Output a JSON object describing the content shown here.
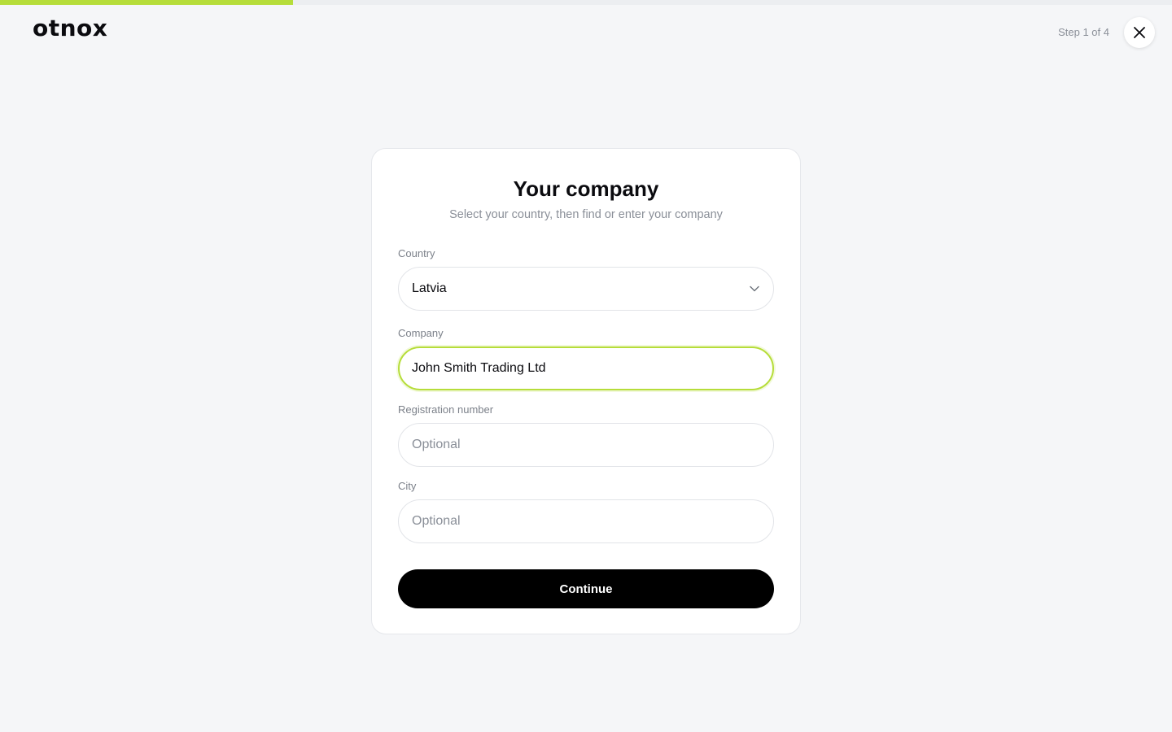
{
  "header": {
    "logo_text": "otnox",
    "step_label": "Step 1 of 4",
    "close_icon": "close-icon"
  },
  "progress": {
    "fraction": 0.25,
    "color": "#b6dd3a"
  },
  "card": {
    "title": "Your company",
    "subtitle": "Select your country, then find or enter your company",
    "country": {
      "label": "Country",
      "value": "Latvia",
      "icon": "chevron-down-icon"
    },
    "company": {
      "label": "Company",
      "value": "John Smith Trading Ltd"
    },
    "registration": {
      "label": "Registration number",
      "placeholder": "Optional"
    },
    "city": {
      "label": "City",
      "placeholder": "Optional"
    },
    "continue_label": "Continue"
  },
  "colors": {
    "accent": "#b6dd3a",
    "background": "#f5f6f8",
    "button": "#000000"
  }
}
